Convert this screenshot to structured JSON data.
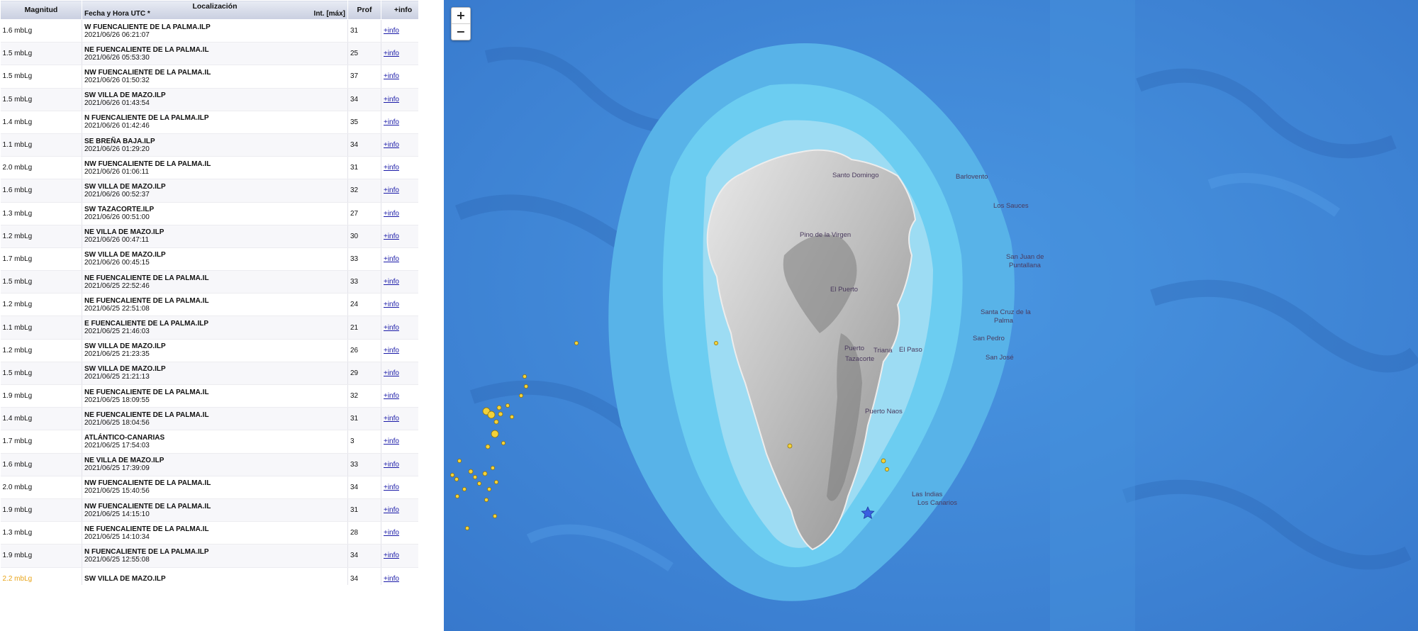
{
  "table": {
    "headers": {
      "magnitude": "Magnitud",
      "location": "Localización",
      "datetime": "Fecha y Hora UTC *",
      "intensity": "Int. [máx]",
      "depth": "Prof",
      "info": "+info"
    },
    "rows": [
      {
        "mag": "1.6 mbLg",
        "place": "W FUENCALIENTE DE LA PALMA.ILP",
        "date": "2021/06/26 06:21:07",
        "depth": "31",
        "info": "+info"
      },
      {
        "mag": "1.5 mbLg",
        "place": "NE FUENCALIENTE DE LA PALMA.IL",
        "date": "2021/06/26 05:53:30",
        "depth": "25",
        "info": "+info"
      },
      {
        "mag": "1.5 mbLg",
        "place": "NW FUENCALIENTE DE LA PALMA.IL",
        "date": "2021/06/26 01:50:32",
        "depth": "37",
        "info": "+info"
      },
      {
        "mag": "1.5 mbLg",
        "place": "SW VILLA DE MAZO.ILP",
        "date": "2021/06/26 01:43:54",
        "depth": "34",
        "info": "+info"
      },
      {
        "mag": "1.4 mbLg",
        "place": "N FUENCALIENTE DE LA PALMA.ILP",
        "date": "2021/06/26 01:42:46",
        "depth": "35",
        "info": "+info"
      },
      {
        "mag": "1.1 mbLg",
        "place": "SE BREÑA BAJA.ILP",
        "date": "2021/06/26 01:29:20",
        "depth": "34",
        "info": "+info"
      },
      {
        "mag": "2.0 mbLg",
        "place": "NW FUENCALIENTE DE LA PALMA.IL",
        "date": "2021/06/26 01:06:11",
        "depth": "31",
        "info": "+info"
      },
      {
        "mag": "1.6 mbLg",
        "place": "SW VILLA DE MAZO.ILP",
        "date": "2021/06/26 00:52:37",
        "depth": "32",
        "info": "+info"
      },
      {
        "mag": "1.3 mbLg",
        "place": "SW TAZACORTE.ILP",
        "date": "2021/06/26 00:51:00",
        "depth": "27",
        "info": "+info"
      },
      {
        "mag": "1.2 mbLg",
        "place": "NE VILLA DE MAZO.ILP",
        "date": "2021/06/26 00:47:11",
        "depth": "30",
        "info": "+info"
      },
      {
        "mag": "1.7 mbLg",
        "place": "SW VILLA DE MAZO.ILP",
        "date": "2021/06/26 00:45:15",
        "depth": "33",
        "info": "+info"
      },
      {
        "mag": "1.5 mbLg",
        "place": "NE FUENCALIENTE DE LA PALMA.IL",
        "date": "2021/06/25 22:52:46",
        "depth": "33",
        "info": "+info"
      },
      {
        "mag": "1.2 mbLg",
        "place": "NE FUENCALIENTE DE LA PALMA.IL",
        "date": "2021/06/25 22:51:08",
        "depth": "24",
        "info": "+info"
      },
      {
        "mag": "1.1 mbLg",
        "place": "E FUENCALIENTE DE LA PALMA.ILP",
        "date": "2021/06/25 21:46:03",
        "depth": "21",
        "info": "+info"
      },
      {
        "mag": "1.2 mbLg",
        "place": "SW VILLA DE MAZO.ILP",
        "date": "2021/06/25 21:23:35",
        "depth": "26",
        "info": "+info"
      },
      {
        "mag": "1.5 mbLg",
        "place": "SW VILLA DE MAZO.ILP",
        "date": "2021/06/25 21:21:13",
        "depth": "29",
        "info": "+info"
      },
      {
        "mag": "1.9 mbLg",
        "place": "NE FUENCALIENTE DE LA PALMA.IL",
        "date": "2021/06/25 18:09:55",
        "depth": "32",
        "info": "+info"
      },
      {
        "mag": "1.4 mbLg",
        "place": "NE FUENCALIENTE DE LA PALMA.IL",
        "date": "2021/06/25 18:04:56",
        "depth": "31",
        "info": "+info"
      },
      {
        "mag": "1.7 mbLg",
        "place": "ATLÁNTICO-CANARIAS",
        "date": "2021/06/25 17:54:03",
        "depth": "3",
        "info": "+info"
      },
      {
        "mag": "1.6 mbLg",
        "place": "NE VILLA DE MAZO.ILP",
        "date": "2021/06/25 17:39:09",
        "depth": "33",
        "info": "+info"
      },
      {
        "mag": "2.0 mbLg",
        "place": "NW FUENCALIENTE DE LA PALMA.IL",
        "date": "2021/06/25 15:40:56",
        "depth": "34",
        "info": "+info"
      },
      {
        "mag": "1.9 mbLg",
        "place": "NW FUENCALIENTE DE LA PALMA.IL",
        "date": "2021/06/25 14:15:10",
        "depth": "31",
        "info": "+info"
      },
      {
        "mag": "1.3 mbLg",
        "place": "NE FUENCALIENTE DE LA PALMA.IL",
        "date": "2021/06/25 14:10:34",
        "depth": "28",
        "info": "+info"
      },
      {
        "mag": "1.9 mbLg",
        "place": "N FUENCALIENTE DE LA PALMA.ILP",
        "date": "2021/06/25 12:55:08",
        "depth": "34",
        "info": "+info"
      }
    ],
    "partial_row": {
      "mag": "2.2 mbLg",
      "place": "SW VILLA DE MAZO.ILP",
      "date": "",
      "depth": "34",
      "info": "+info"
    }
  },
  "map": {
    "zoom_in": "+",
    "zoom_out": "−",
    "towns": [
      "Santo Domingo",
      "Barlovento",
      "Los Sauces",
      "Pino de la Virgen",
      "San Juan de",
      "Puntallana",
      "El Puerto",
      "Santa Cruz de la",
      "Palma",
      "San Pedro",
      "Puerto",
      "Tazacorte",
      "Triana",
      "El Paso",
      "San José",
      "Puerto Naos",
      "Las Indias",
      "Los Canarios"
    ],
    "colors": {
      "deep_ocean": "#3b86d9",
      "shelf": "#5cc0ee",
      "shallow": "#9fdcf2",
      "land": "#c9c9c9",
      "quake": "#f2d13a",
      "star": "#3a5fe0"
    }
  }
}
